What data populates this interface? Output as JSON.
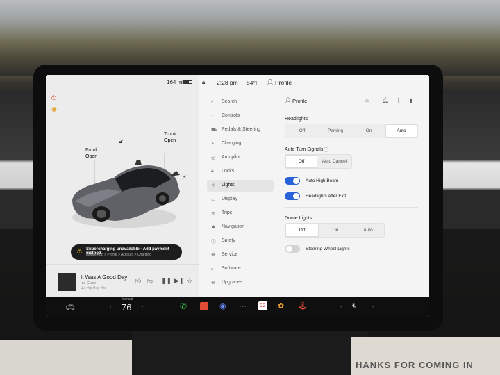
{
  "status": {
    "range": "164 mi",
    "time": "2:28 pm",
    "temperature": "54°F",
    "profile": "Profile"
  },
  "car": {
    "frunk_label": "Frunk",
    "frunk_state": "Open",
    "trunk_label": "Trunk",
    "trunk_state": "Open"
  },
  "alert": {
    "title": "Supercharging unavailable - Add payment method",
    "path": "Mobile App > Profile > Account > Charging"
  },
  "media": {
    "song": "It Was A Good Day",
    "artist": "Ice Cube",
    "station": "'Ꮂc Hip Hop Hits"
  },
  "menu": {
    "search": "Search",
    "items": [
      {
        "label": "Controls",
        "icon": "toggle-icon"
      },
      {
        "label": "Pedals & Steering",
        "icon": "car-icon"
      },
      {
        "label": "Charging",
        "icon": "bolt-icon"
      },
      {
        "label": "Autopilot",
        "icon": "steering-wheel-icon"
      },
      {
        "label": "Locks",
        "icon": "lock-icon"
      },
      {
        "label": "Lights",
        "icon": "lightbulb-icon"
      },
      {
        "label": "Display",
        "icon": "display-icon"
      },
      {
        "label": "Trips",
        "icon": "trips-icon"
      },
      {
        "label": "Navigation",
        "icon": "navigation-icon"
      },
      {
        "label": "Safety",
        "icon": "safety-icon"
      },
      {
        "label": "Service",
        "icon": "wrench-icon"
      },
      {
        "label": "Software",
        "icon": "download-icon"
      },
      {
        "label": "Upgrades",
        "icon": "upgrades-icon"
      }
    ],
    "active": "Lights"
  },
  "settings": {
    "profile_label": "Profile",
    "headlights": {
      "title": "Headlights",
      "options": [
        "Off",
        "Parking",
        "On",
        "Auto"
      ],
      "selected": "Auto"
    },
    "auto_turn_signals": {
      "title": "Auto Turn Signals",
      "options": [
        "Off",
        "Auto Cancel"
      ],
      "selected": "Off"
    },
    "auto_high_beam": {
      "label": "Auto High Beam",
      "on": true
    },
    "headlights_after_exit": {
      "label": "Headlights after Exit",
      "on": true
    },
    "dome_lights": {
      "title": "Dome Lights",
      "options": [
        "Off",
        "On",
        "Auto"
      ],
      "selected": "Off"
    },
    "steering_wheel_lights": {
      "label": "Steering Wheel Lights",
      "on": false
    }
  },
  "taskbar": {
    "temp_mode": "Manual",
    "temperature": "76",
    "calendar_day": "22"
  },
  "colors": {
    "toggle_on": "#2a62d9",
    "toggle_off": "#d4d4d4",
    "alert_bg": "#1d1d1d",
    "phone_green": "#3bbf4a",
    "audio_red": "#e24b35",
    "charge_red": "#e0522e"
  },
  "background": {
    "sign_text": "HANKS FOR COMING IN"
  }
}
